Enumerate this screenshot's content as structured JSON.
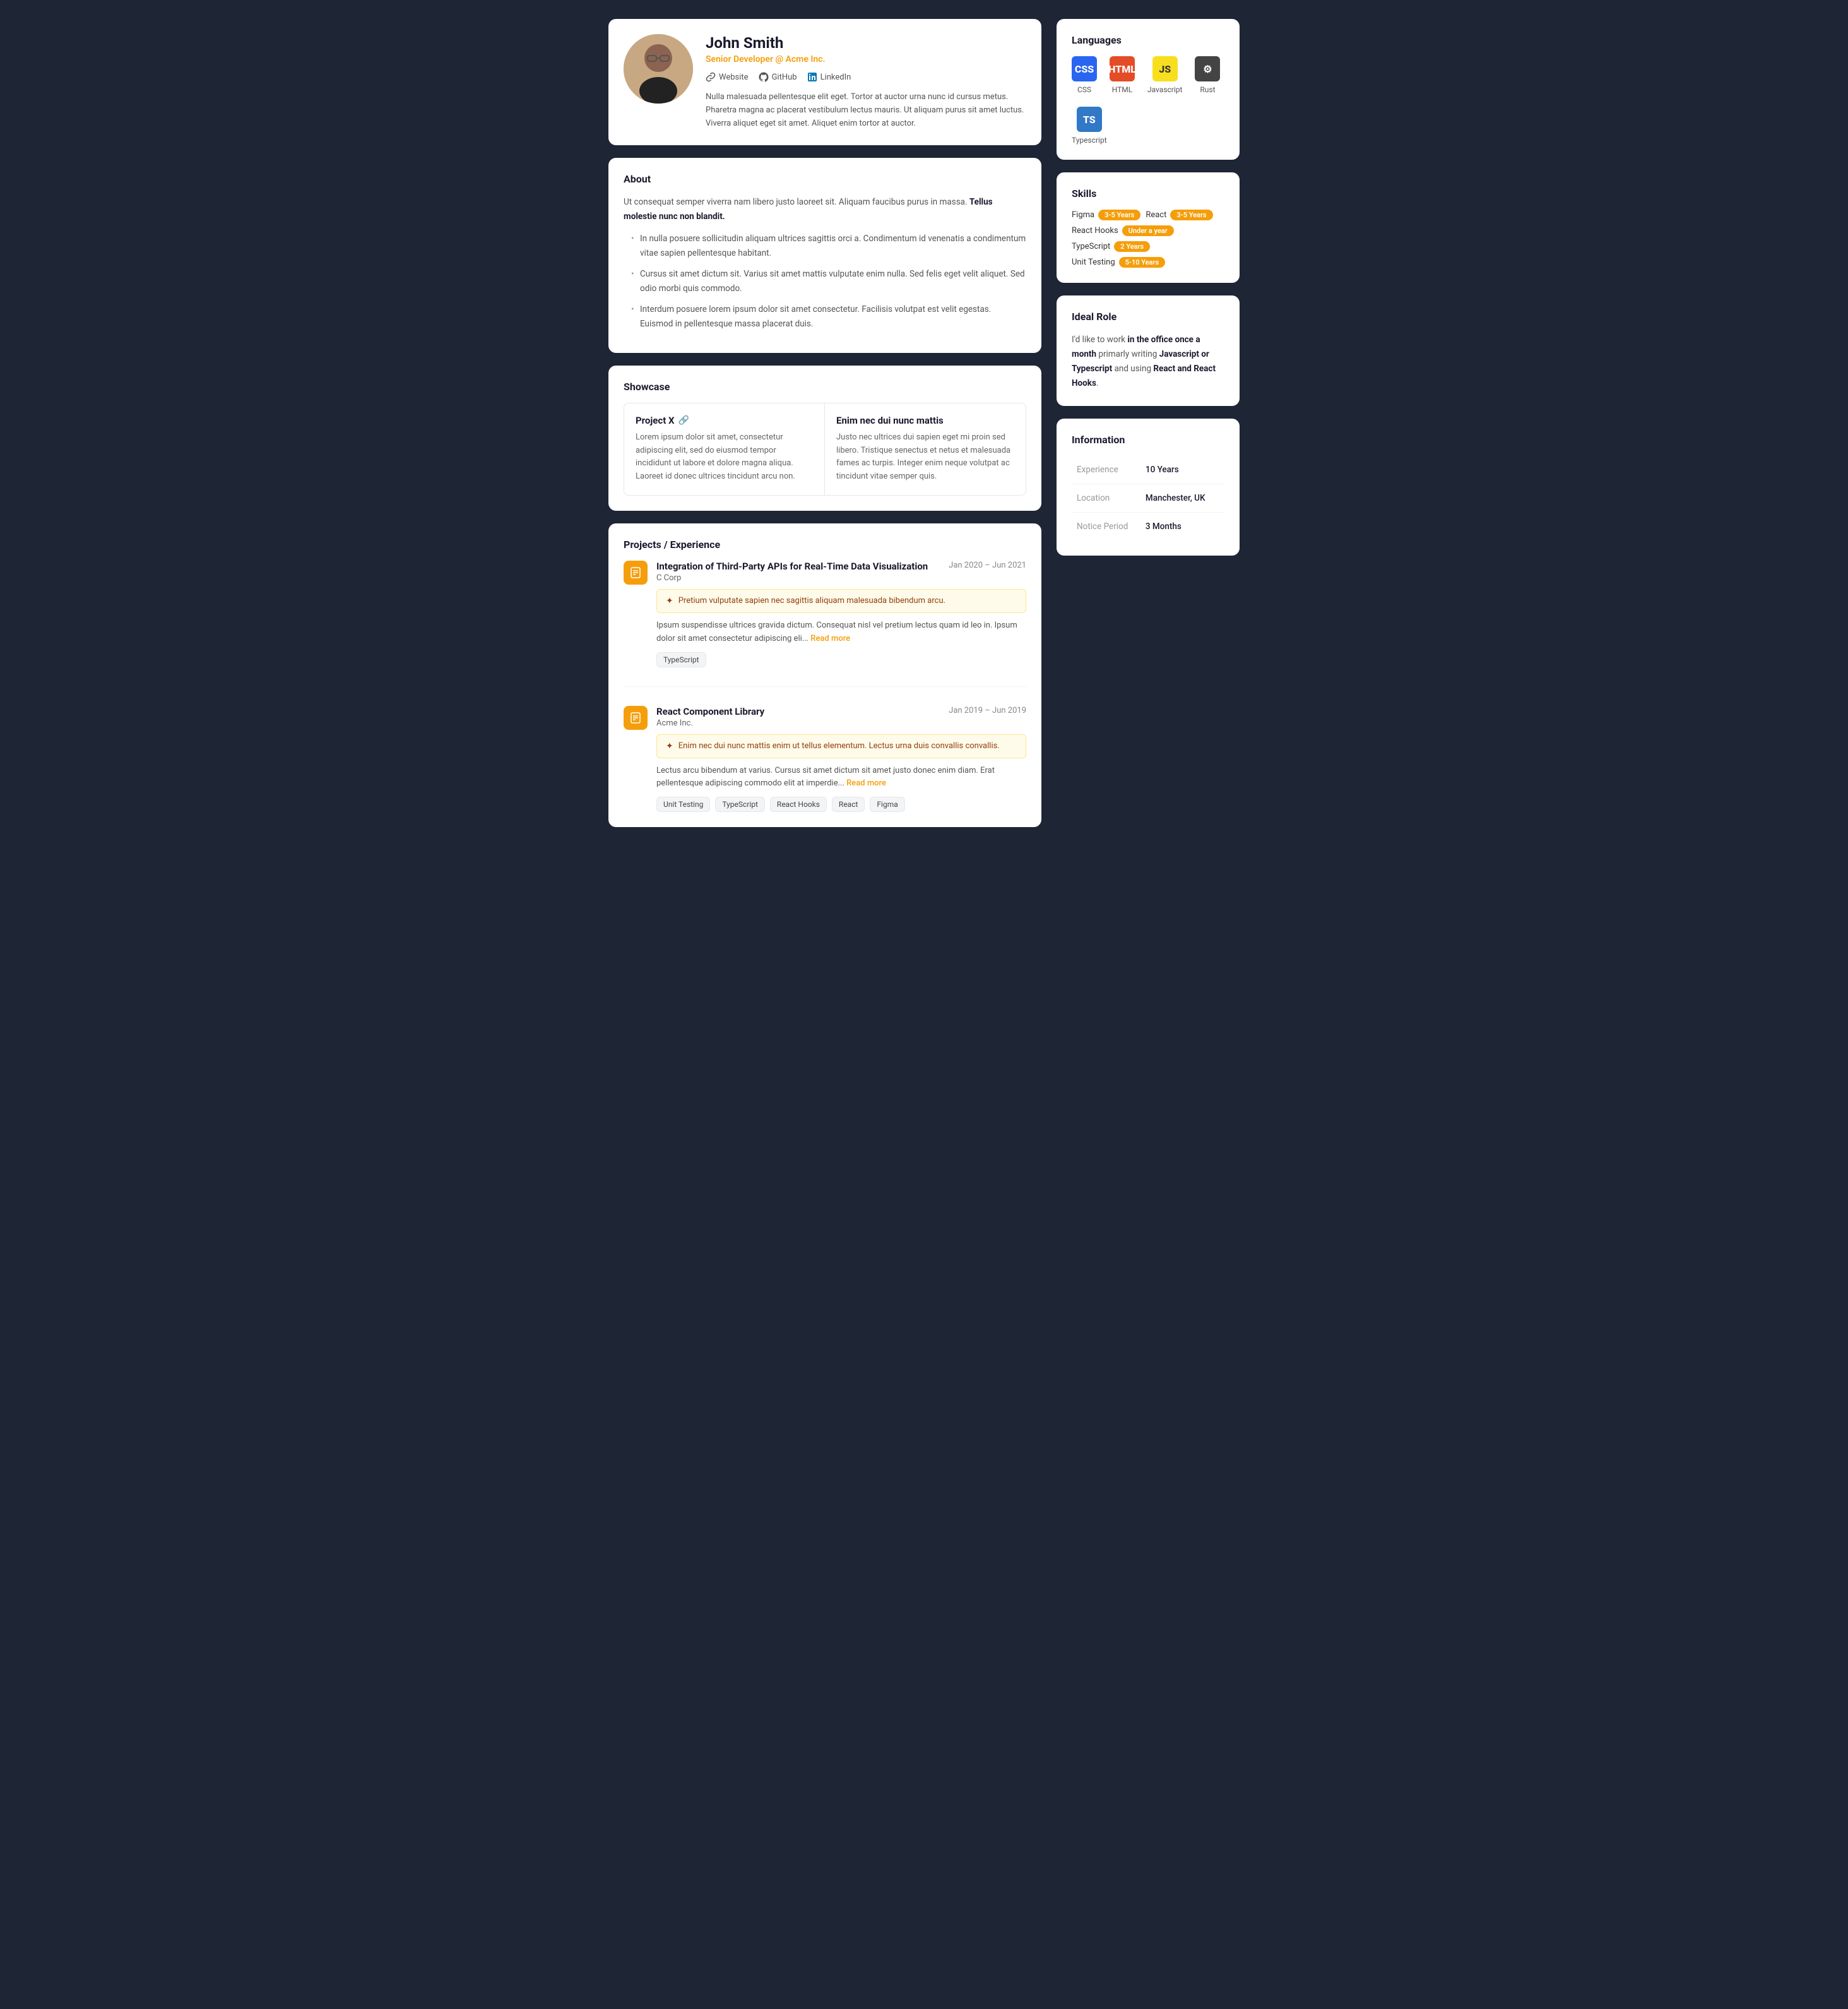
{
  "profile": {
    "name": "John Smith",
    "subtitle": "Senior Developer @ Acme Inc.",
    "links": [
      {
        "label": "Website",
        "icon": "link"
      },
      {
        "label": "GitHub",
        "icon": "github"
      },
      {
        "label": "LinkedIn",
        "icon": "linkedin"
      }
    ],
    "bio": "Nulla malesuada pellentesque elit eget. Tortor at auctor urna nunc id cursus metus. Pharetra magna ac placerat vestibulum lectus mauris. Ut aliquam purus sit amet luctus. Viverra aliquet eget sit amet. Aliquet enim tortor at auctor."
  },
  "about": {
    "title": "About",
    "intro": "Ut consequat semper viverra nam libero justo laoreet sit. Aliquam faucibus purus in massa.",
    "intro_bold": "Tellus molestie nunc non blandit.",
    "bullets": [
      "In nulla posuere sollicitudin aliquam ultrices sagittis orci a. Condimentum id venenatis a condimentum vitae sapien pellentesque habitant.",
      "Cursus sit amet dictum sit. Varius sit amet mattis vulputate enim nulla. Sed felis eget velit aliquet. Sed odio morbi quis commodo.",
      "Interdum posuere lorem ipsum dolor sit amet consectetur. Facilisis volutpat est velit egestas. Euismod in pellentesque massa placerat duis."
    ]
  },
  "showcase": {
    "title": "Showcase",
    "items": [
      {
        "title": "Project X",
        "has_link": true,
        "desc": "Lorem ipsum dolor sit amet, consectetur adipiscing elit, sed do eiusmod tempor incididunt ut labore et dolore magna aliqua. Laoreet id donec ultrices tincidunt arcu non."
      },
      {
        "title": "Enim nec dui nunc mattis",
        "has_link": false,
        "desc": "Justo nec ultrices dui sapien eget mi proin sed libero. Tristique senectus et netus et malesuada fames ac turpis. Integer enim neque volutpat ac tincidunt vitae semper quis."
      }
    ]
  },
  "projects": {
    "title": "Projects / Experience",
    "items": [
      {
        "icon": "📋",
        "title": "Integration of Third-Party APIs for Real-Time Data Visualization",
        "company": "C Corp",
        "date_start": "Jan 2020",
        "date_end": "Jun 2021",
        "highlight": "Pretium vulputate sapien nec sagittis aliquam malesuada bibendum arcu.",
        "desc": "Ipsum suspendisse ultrices gravida dictum. Consequat nisl vel pretium lectus quam id leo in. Ipsum dolor sit amet consectetur adipiscing eli...",
        "read_more": "Read more",
        "tags": [
          "TypeScript"
        ]
      },
      {
        "icon": "📋",
        "title": "React Component Library",
        "company": "Acme Inc.",
        "date_start": "Jan 2019",
        "date_end": "Jun 2019",
        "highlight": "Enim nec dui nunc mattis enim ut tellus elementum. Lectus urna duis convallis convallis.",
        "desc": "Lectus arcu bibendum at varius. Cursus sit amet dictum sit amet justo donec enim diam. Erat pellentesque adipiscing commodo elit at imperdie...",
        "read_more": "Read more",
        "tags": [
          "Unit Testing",
          "TypeScript",
          "React Hooks",
          "React",
          "Figma"
        ]
      }
    ]
  },
  "languages": {
    "title": "Languages",
    "items": [
      {
        "label": "CSS",
        "abbr": "CSS",
        "color": "#2965f1"
      },
      {
        "label": "HTML",
        "abbr": "HTML",
        "color": "#e34c26"
      },
      {
        "label": "Javascript",
        "abbr": "JS",
        "color": "#f7df1e",
        "text_color": "#333"
      },
      {
        "label": "Rust",
        "abbr": "⚙",
        "color": "#444"
      },
      {
        "label": "Typescript",
        "abbr": "TS",
        "color": "#3178c6"
      }
    ]
  },
  "skills": {
    "title": "Skills",
    "items": [
      {
        "name": "Figma",
        "years": "3-5 Years",
        "color": "yellow"
      },
      {
        "name": "React",
        "years": "3-5 Years",
        "color": "yellow"
      },
      {
        "name": "React Hooks",
        "years": "Under a year",
        "color": "yellow"
      },
      {
        "name": "TypeScript",
        "years": "2 Years",
        "color": "yellow"
      },
      {
        "name": "Unit Testing",
        "years": "5-10 Years",
        "color": "yellow"
      }
    ]
  },
  "ideal_role": {
    "title": "Ideal Role",
    "text_parts": [
      "I'd like to work ",
      "in the office once a month",
      " primarly writing ",
      "Javascript or Typescript",
      " and using ",
      "React and React Hooks",
      "."
    ]
  },
  "information": {
    "title": "Information",
    "rows": [
      {
        "label": "Experience",
        "value": "10 Years"
      },
      {
        "label": "Location",
        "value": "Manchester, UK"
      },
      {
        "label": "Notice Period",
        "value": "3 Months"
      }
    ]
  }
}
